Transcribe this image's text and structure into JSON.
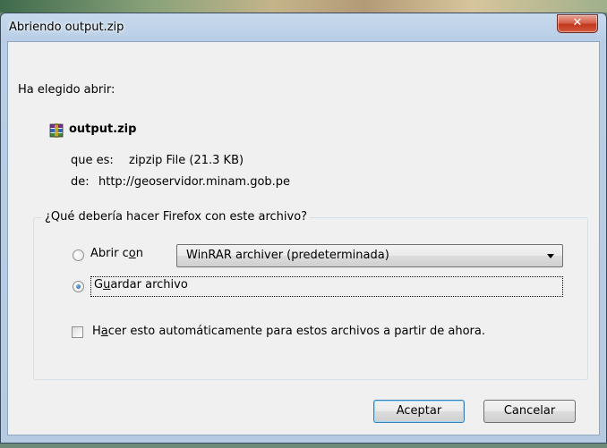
{
  "window": {
    "title": "Abriendo output.zip",
    "close_glyph": "✕"
  },
  "intro": "Ha elegido abrir:",
  "file": {
    "name": "output.zip",
    "icon": "winrar-archive-icon",
    "type_label": "que es:",
    "type_value": "zipzip File (21.3 KB)",
    "source_label": "de:",
    "source_value": "http://geoservidor.minam.gob.pe"
  },
  "action_group": {
    "legend": "¿Qué debería hacer Firefox con este archivo?",
    "open_with_label_pre": "Abrir c",
    "open_with_label_key": "o",
    "open_with_label_post": "n",
    "open_with_value": "WinRAR archiver (predeterminada)",
    "save_label_pre": "G",
    "save_label_key": "u",
    "save_label_post": "ardar archivo",
    "selected": "save",
    "auto_label_pre": "H",
    "auto_label_key": "a",
    "auto_label_post": "cer esto automáticamente para estos archivos a partir de ahora.",
    "auto_checked": false
  },
  "buttons": {
    "ok": "Aceptar",
    "cancel": "Cancelar"
  },
  "colors": {
    "titlebar": "#b9cee6",
    "close": "#c2371f",
    "default_button_border": "#3c7fb1"
  }
}
